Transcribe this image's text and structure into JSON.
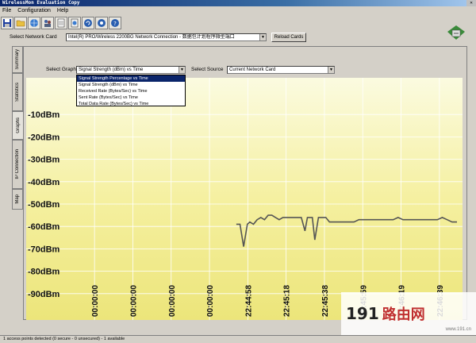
{
  "window": {
    "title": "WirelessMon Evaluation Copy"
  },
  "menu": [
    "File",
    "Configuration",
    "Help"
  ],
  "toolbar": {
    "icons": [
      "save-icon",
      "open-folder-icon",
      "globe-icon",
      "users-icon",
      "document-icon",
      "log-icon",
      "refresh-icon",
      "settings-icon",
      "help-icon"
    ]
  },
  "card": {
    "label": "Select Network Card",
    "value": "Intel(R) PRO/Wireless 2200BG Network Connection - 数据包计划程序微型端口",
    "reload": "Reload Cards"
  },
  "tabs": [
    "Summary",
    "Statistics",
    "Graphs",
    "IP Connection",
    "Map"
  ],
  "graph": {
    "select_label": "Select Graph",
    "select_value": "Signal Strength (dBm) vs Time",
    "source_label": "Select Source",
    "source_value": "Current Network Card",
    "options": [
      "Signal Strength Percentage vs Time",
      "Signal Strength (dBm) vs Time",
      "Received Rate (Bytes/Sec) vs Time",
      "Sent Rate (Bytes/Sec) vs Time",
      "Total Data Rate (Bytes/Sec) vs Time"
    ]
  },
  "chart_data": {
    "type": "line",
    "title": "",
    "xlabel": "",
    "ylabel": "",
    "y_ticks": [
      "-10dBm",
      "-20dBm",
      "-30dBm",
      "-40dBm",
      "-50dBm",
      "-60dBm",
      "-70dBm",
      "-80dBm",
      "-90dBm"
    ],
    "y_values": [
      -10,
      -20,
      -30,
      -40,
      -50,
      -60,
      -70,
      -80,
      -90
    ],
    "ylim": [
      -100,
      0
    ],
    "x_ticks": [
      "00:00:00",
      "00:00:00",
      "00:00:00",
      "00:00:00",
      "22:44:58",
      "22:45:18",
      "22:45:38",
      "22:45:59",
      "22:46:19",
      "22:46:39"
    ],
    "grid": true,
    "series": [
      {
        "color": "#555555",
        "x": [
          0,
          0.3,
          0.6,
          0.9,
          1.1,
          1.4,
          1.7,
          2.0,
          2.3,
          2.6,
          2.9,
          3.2,
          3.5,
          3.8,
          4.1,
          4.4,
          4.7,
          5.0,
          5.3,
          5.6,
          5.8,
          6.0,
          6.2,
          6.4,
          6.7,
          7.0,
          7.3,
          7.6,
          8.0,
          8.4,
          8.8,
          9.2,
          9.6,
          10.0,
          10.4,
          10.8,
          11.2,
          11.6,
          12.0,
          12.4,
          12.8,
          13.2,
          13.6,
          14.0,
          14.4,
          14.8,
          15.2,
          15.6,
          16.0,
          16.4,
          16.8,
          17.2,
          17.6,
          18.0
        ],
        "values": [
          -59,
          -59,
          -69,
          -59,
          -58,
          -59,
          -57,
          -56,
          -57,
          -55,
          -55,
          -56,
          -57,
          -56,
          -56,
          -56,
          -56,
          -56,
          -56,
          -62,
          -56,
          -56,
          -56,
          -66,
          -56,
          -56,
          -56,
          -58,
          -58,
          -58,
          -58,
          -58,
          -58,
          -57,
          -57,
          -57,
          -57,
          -57,
          -57,
          -57,
          -57,
          -56,
          -57,
          -57,
          -57,
          -57,
          -57,
          -57,
          -57,
          -57,
          -56,
          -57,
          -58,
          -58
        ]
      }
    ]
  },
  "status": {
    "text": "1 access points detected (0 secure - 0 unsecured) - 1 available"
  },
  "watermark": {
    "num": "191",
    "brand": "路由网",
    "url": "www.191.cn"
  }
}
